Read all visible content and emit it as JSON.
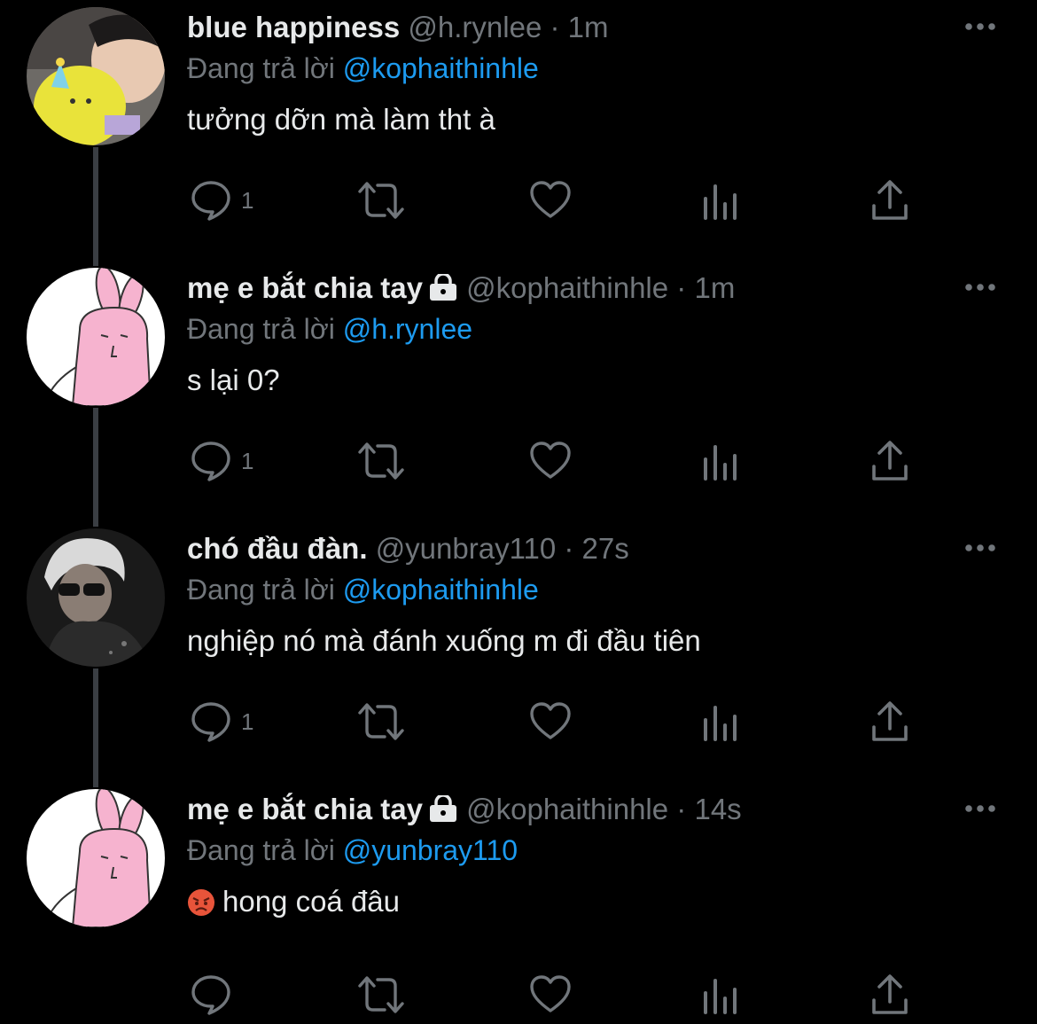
{
  "colors": {
    "background": "#000000",
    "text": "#e7e9ea",
    "secondary": "#71767b",
    "mention": "#1d9bf0",
    "thread_line": "#3a3e43"
  },
  "tweets": [
    {
      "name": "blue happiness",
      "handle": "@h.rynlee",
      "separator": "·",
      "time": "1m",
      "replying_prefix": "Đang trả lời",
      "replying_to": "@kophaithinhle",
      "text": "tưởng dỡn mà làm tht à",
      "reply_count": "1",
      "protected": false
    },
    {
      "name": "mẹ e bắt chia tay",
      "handle": "@kophaithinhle",
      "separator": "·",
      "time": "1m",
      "replying_prefix": "Đang trả lời",
      "replying_to": "@h.rynlee",
      "text": "s lại 0?",
      "reply_count": "1",
      "protected": true
    },
    {
      "name": "chó đầu đàn.",
      "handle": "@yunbray110",
      "separator": "·",
      "time": "27s",
      "replying_prefix": "Đang trả lời",
      "replying_to": "@kophaithinhle",
      "text": "nghiệp nó mà đánh xuống m đi đầu tiên",
      "reply_count": "1",
      "protected": false
    },
    {
      "name": "mẹ e bắt chia tay",
      "handle": "@kophaithinhle",
      "separator": "·",
      "time": "14s",
      "replying_prefix": "Đang trả lời",
      "replying_to": "@yunbray110",
      "text": "hong coá đâu",
      "reply_count": "",
      "protected": true,
      "text_emoji": "angry-face-emoji"
    }
  ],
  "icons": {
    "reply": "reply-bubble-icon",
    "retweet": "retweet-icon",
    "like": "heart-icon",
    "views": "analytics-bars-icon",
    "share": "share-upload-icon",
    "more": "more-dots-icon",
    "lock": "lock-icon"
  }
}
